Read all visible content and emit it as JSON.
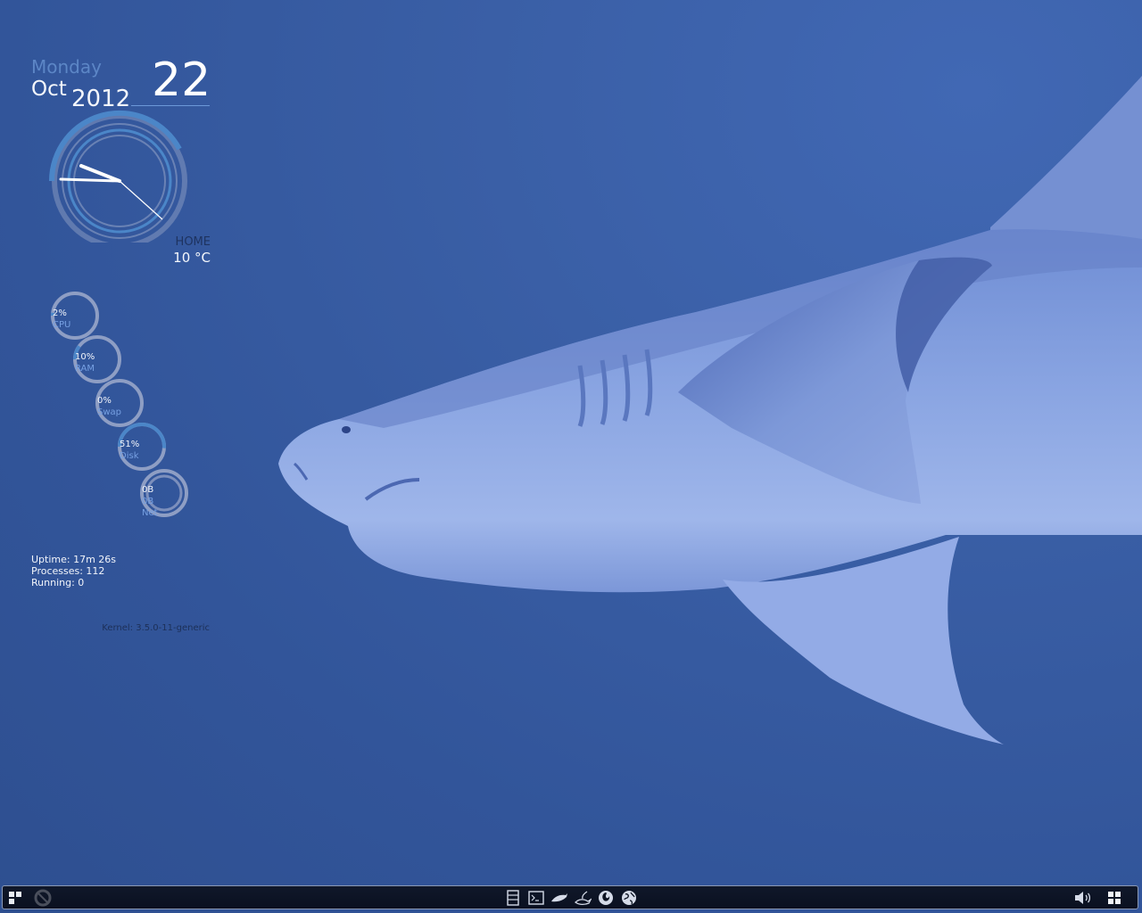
{
  "date": {
    "day_name": "Monday",
    "month": "Oct",
    "year": "2012",
    "day": "22"
  },
  "weather": {
    "location": "HOME",
    "temperature": "10 °C"
  },
  "system": {
    "cpu": {
      "value": "2%",
      "label": "CPU",
      "percent": 2
    },
    "ram": {
      "value": "10%",
      "label": "RAM",
      "percent": 10
    },
    "swap": {
      "value": "0%",
      "label": "Swap",
      "percent": 0
    },
    "disk": {
      "value": "51%",
      "label": "Disk",
      "percent": 51
    },
    "net": {
      "down": "0B",
      "up": "0B",
      "label": "Net"
    }
  },
  "info": {
    "uptime": "Uptime: 17m 26s",
    "processes": "Processes: 112",
    "running": "Running: 0"
  },
  "kernel": "Kernel: 3.5.0-11-generic",
  "colors": {
    "accent": "#4b86c8",
    "ring_track": "#8e9ec4",
    "label_blue": "#76a0e2"
  },
  "taskbar": {
    "left_icons": [
      "start-menu-icon",
      "ubuntu-logo-icon"
    ],
    "center_icons": [
      "file-manager-icon",
      "terminal-icon",
      "dolphin-icon",
      "genie-lamp-icon",
      "firefox-icon",
      "globe-icon"
    ],
    "right_icons": [
      "volume-icon",
      "workspace-switcher-icon"
    ]
  }
}
